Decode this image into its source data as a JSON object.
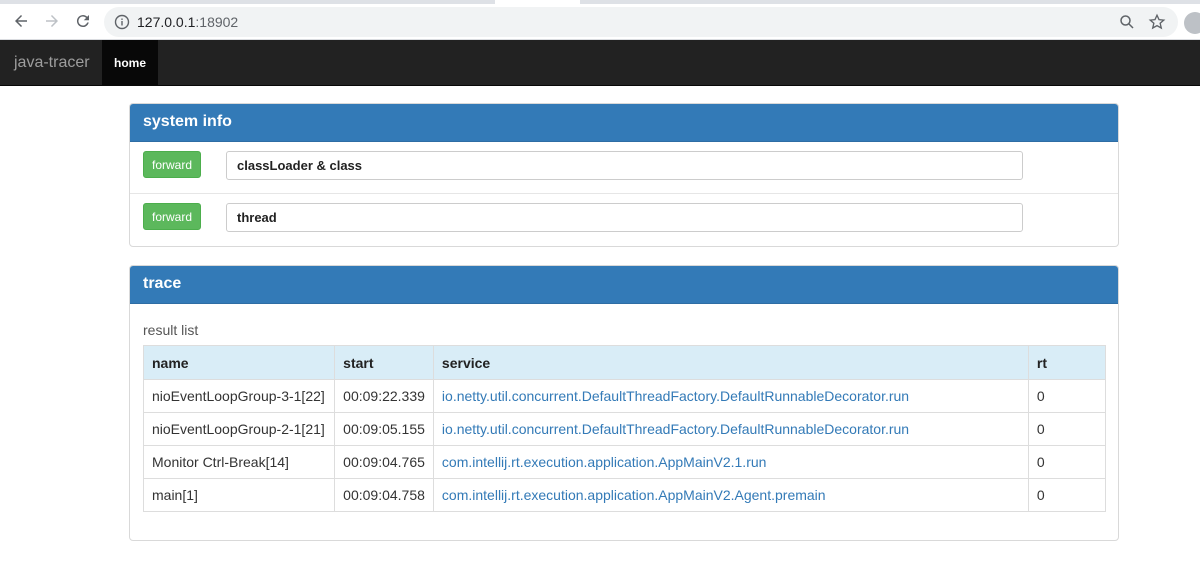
{
  "browser": {
    "url_host": "127.0.0.1",
    "url_port": ":18902"
  },
  "navbar": {
    "brand": "java-tracer",
    "home_label": "home"
  },
  "system_info": {
    "title": "system info",
    "rows": [
      {
        "button_label": "forward",
        "value": "classLoader & class"
      },
      {
        "button_label": "forward",
        "value": "thread"
      }
    ]
  },
  "trace": {
    "title": "trace",
    "result_label": "result list",
    "columns": [
      "name",
      "start",
      "service",
      "rt"
    ],
    "rows": [
      {
        "name": "nioEventLoopGroup-3-1[22]",
        "start": "00:09:22.339",
        "service": "io.netty.util.concurrent.DefaultThreadFactory.DefaultRunnableDecorator.run",
        "rt": "0"
      },
      {
        "name": "nioEventLoopGroup-2-1[21]",
        "start": "00:09:05.155",
        "service": "io.netty.util.concurrent.DefaultThreadFactory.DefaultRunnableDecorator.run",
        "rt": "0"
      },
      {
        "name": "Monitor Ctrl-Break[14]",
        "start": "00:09:04.765",
        "service": "com.intellij.rt.execution.application.AppMainV2.1.run",
        "rt": "0"
      },
      {
        "name": "main[1]",
        "start": "00:09:04.758",
        "service": "com.intellij.rt.execution.application.AppMainV2.Agent.premain",
        "rt": "0"
      }
    ]
  }
}
